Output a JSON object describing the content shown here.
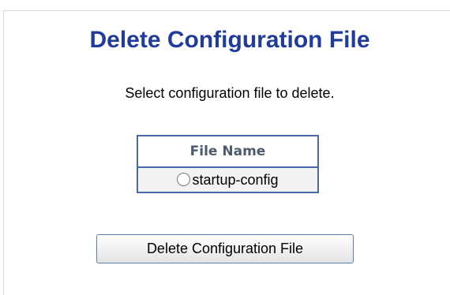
{
  "page": {
    "title": "Delete Configuration File",
    "instructions": "Select configuration file to delete."
  },
  "file_table": {
    "header": "File Name",
    "rows": [
      {
        "name": "startup-config",
        "selected": false
      }
    ]
  },
  "actions": {
    "delete_label": "Delete Configuration File"
  },
  "colors": {
    "title": "#1f3c9c",
    "table_border": "#4a6aa5",
    "header_text": "#4e5b6e",
    "row_background": "#f2f2f2"
  }
}
